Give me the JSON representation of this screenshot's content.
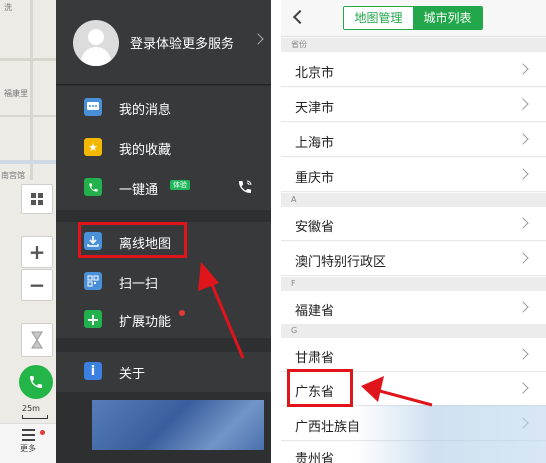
{
  "left_screen": {
    "map": {
      "labels": [
        "洗",
        "福康里",
        "南宫馆"
      ],
      "scale": "25m",
      "more_label": "更多"
    },
    "drawer": {
      "profile_text": "登录体验更多服务",
      "items": [
        {
          "label": "我的消息",
          "icon": "message-icon",
          "color": "#4a90d9"
        },
        {
          "label": "我的收藏",
          "icon": "star-icon",
          "color": "#f5b800"
        },
        {
          "label": "一键通",
          "icon": "phone-icon",
          "color": "#22b14c",
          "badge": "体验"
        },
        {
          "label": "离线地图",
          "icon": "offline-map-icon",
          "color": "#4a90d9",
          "highlighted": true
        },
        {
          "label": "扫一扫",
          "icon": "scan-icon",
          "color": "#4a90d9"
        },
        {
          "label": "扩展功能",
          "icon": "plus-icon",
          "color": "#22b14c"
        },
        {
          "label": "关于",
          "icon": "info-icon",
          "color": "#3b7fe0"
        }
      ]
    }
  },
  "right_screen": {
    "tabs": [
      {
        "label": "地图管理",
        "active": false
      },
      {
        "label": "城市列表",
        "active": true
      }
    ],
    "sections": [
      {
        "header": "省份",
        "items": [
          "北京市",
          "天津市",
          "上海市",
          "重庆市"
        ]
      },
      {
        "header": "A",
        "items": [
          "安徽省",
          "澳门特别行政区"
        ]
      },
      {
        "header": "F",
        "items": [
          "福建省"
        ]
      },
      {
        "header": "G",
        "items": [
          "甘肃省",
          "广东省",
          "广西壮族自",
          "贵州省"
        ]
      }
    ],
    "highlighted_item": "广东省"
  },
  "colors": {
    "accent_green": "#22a84a",
    "highlight_red": "#e0151b",
    "drawer_bg": "#2e2f31"
  }
}
